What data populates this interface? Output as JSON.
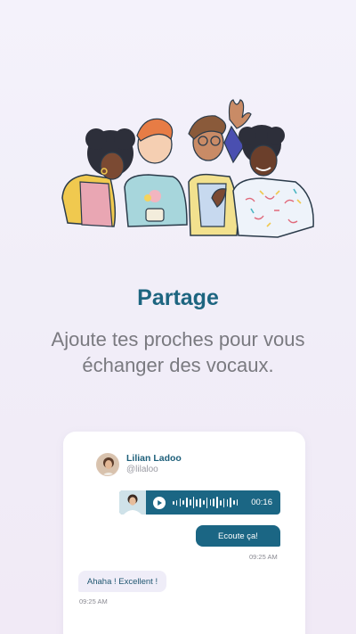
{
  "onboarding": {
    "title": "Partage",
    "subtitle_line1": "Ajoute tes proches pour vous",
    "subtitle_line2": "échanger des vocaux.",
    "illustration_icon": "friends-group-illustration"
  },
  "chat_preview": {
    "contact": {
      "name": "Lilian Ladoo",
      "handle": "@lilaloo"
    },
    "voice_message": {
      "duration": "00:16",
      "icon": "play-icon"
    },
    "sent_message": {
      "text": "Ecoute ça!",
      "time": "09:25 AM"
    },
    "received_message": {
      "text": "Ahaha ! Excellent !",
      "time": "09:25 AM"
    }
  },
  "colors": {
    "brand_teal": "#1d6580",
    "bubble_out": "#1b6684",
    "bubble_in": "#efedf8",
    "subtitle_gray": "#7a7a80"
  }
}
